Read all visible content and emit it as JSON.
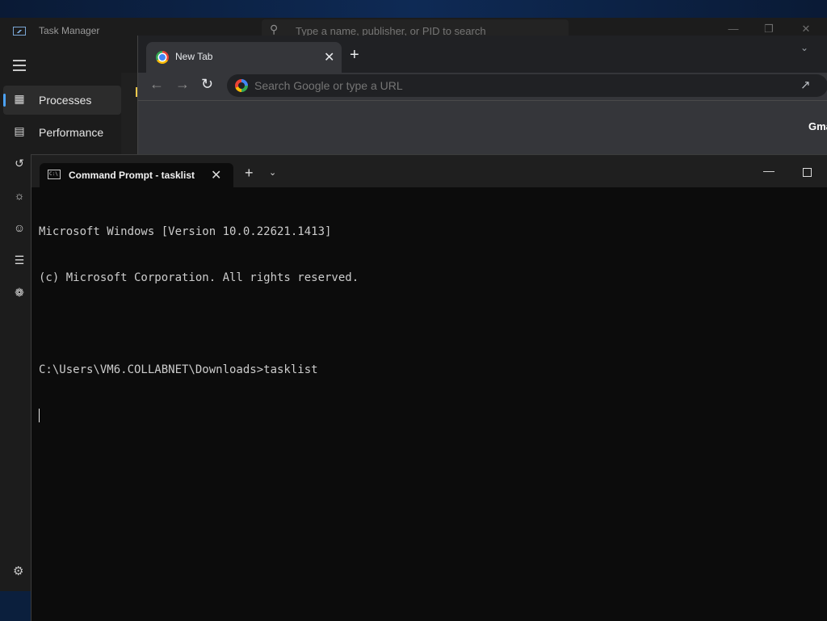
{
  "task_manager": {
    "title": "Task Manager",
    "search_placeholder": "Type a name, publisher, or PID to search",
    "nav": [
      {
        "label": "Processes",
        "icon": "processes-icon",
        "selected": true
      },
      {
        "label": "Performance",
        "icon": "performance-icon",
        "selected": false
      },
      {
        "label": "",
        "icon": "app-history-icon"
      },
      {
        "label": "",
        "icon": "startup-apps-icon"
      },
      {
        "label": "",
        "icon": "users-icon"
      },
      {
        "label": "",
        "icon": "details-icon"
      },
      {
        "label": "",
        "icon": "services-icon"
      }
    ],
    "settings_icon": "settings-icon"
  },
  "chrome": {
    "tab_title": "New Tab",
    "omnibox_placeholder": "Search Google or type a URL",
    "gmail_link": "Gma"
  },
  "terminal": {
    "tab_title": "Command Prompt - tasklist",
    "lines": [
      "Microsoft Windows [Version 10.0.22621.1413]",
      "(c) Microsoft Corporation. All rights reserved.",
      "",
      "C:\\Users\\VM6.COLLABNET\\Downloads>tasklist"
    ]
  },
  "colors": {
    "accent": "#4ca2f5",
    "terminal_bg": "#0c0c0c",
    "chrome_toolbar": "#35363a"
  }
}
